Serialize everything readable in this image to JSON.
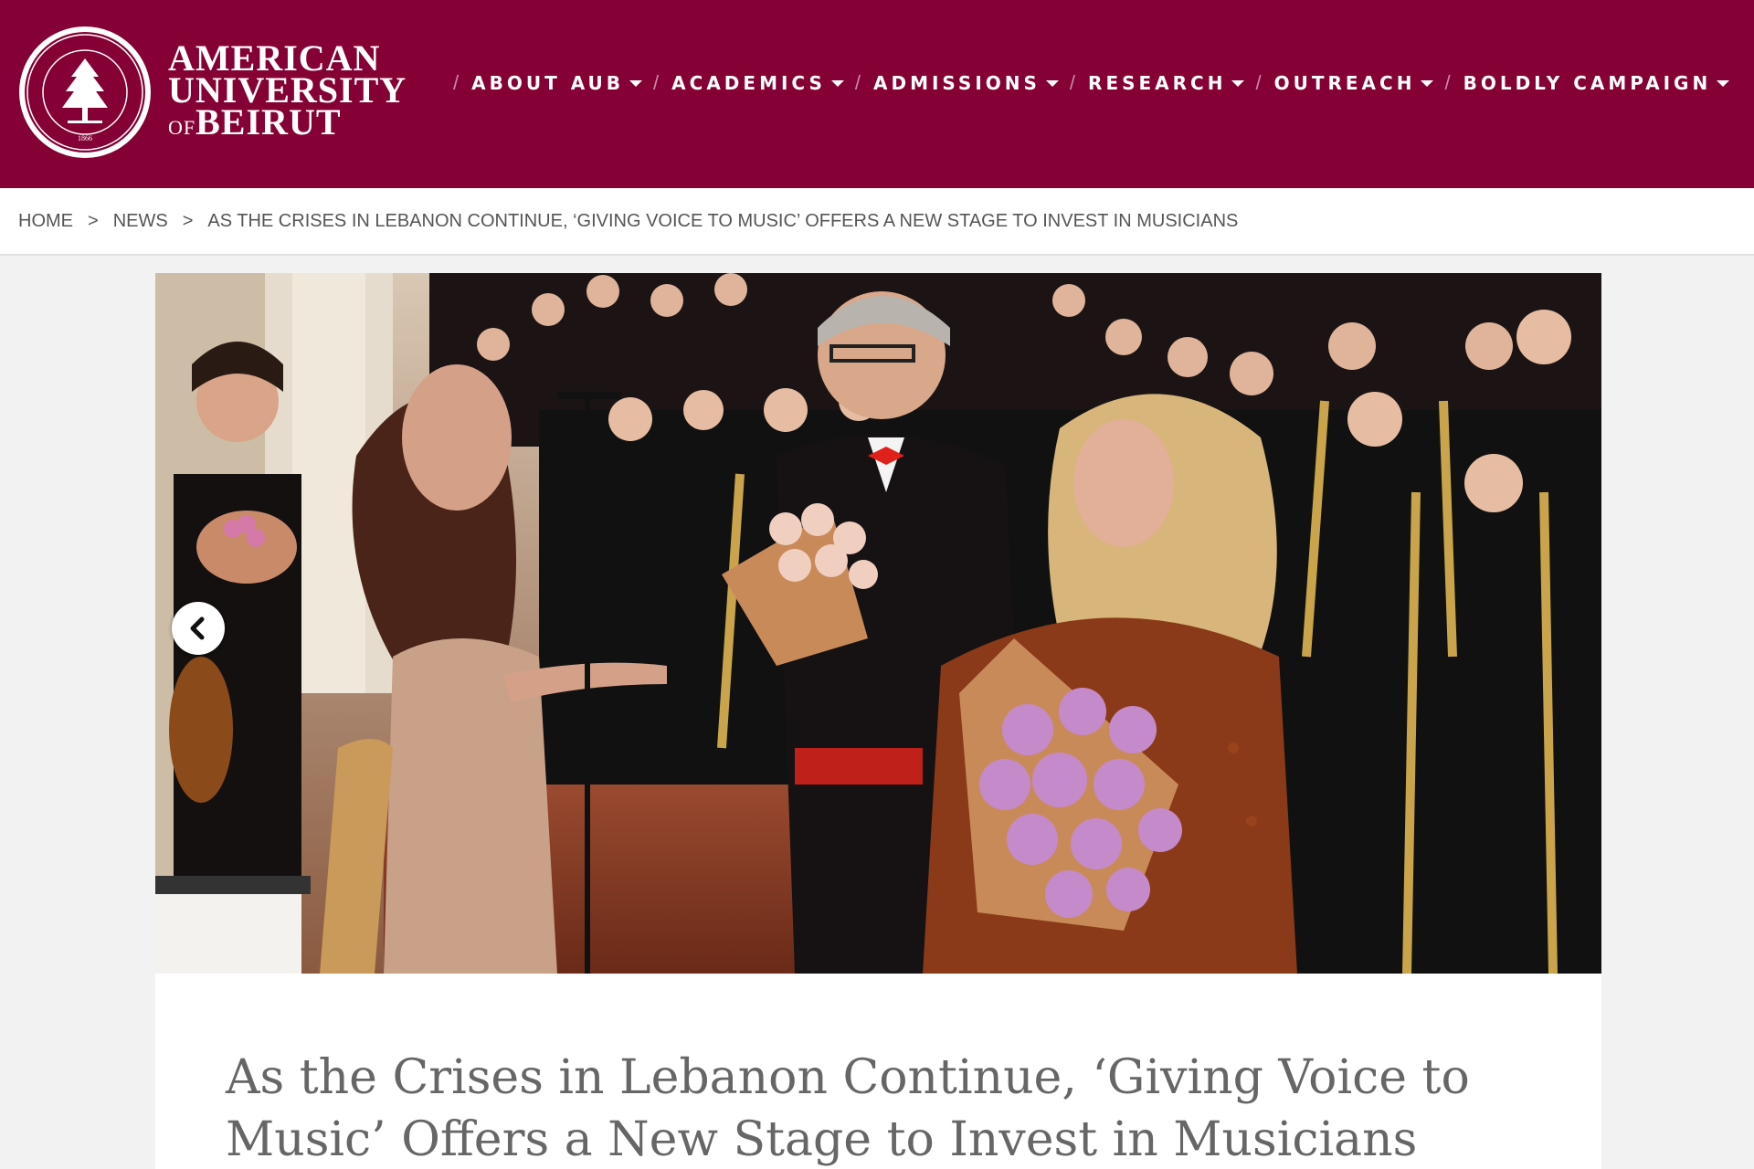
{
  "brand": {
    "line1": "AMERICAN",
    "line2": "UNIVERSITY",
    "line3_of": "OF",
    "line3": "BEIRUT",
    "seal_motto": "UT VITAM HABEANT ABUNDANTIUS HABEANT",
    "seal_year": "1866",
    "color": "#840035"
  },
  "nav": {
    "items": [
      {
        "label": "ABOUT AUB"
      },
      {
        "label": "ACADEMICS"
      },
      {
        "label": "ADMISSIONS"
      },
      {
        "label": "RESEARCH"
      },
      {
        "label": "OUTREACH"
      },
      {
        "label": "BOLDLY CAMPAIGN"
      }
    ]
  },
  "breadcrumb": {
    "home": "HOME",
    "sep": ">",
    "news": "NEWS",
    "current": "AS THE CRISES IN LEBANON CONTINUE, ‘GIVING VOICE TO MUSIC’ OFFERS A NEW STAGE TO INVEST IN MUSICIANS"
  },
  "hero": {
    "prev_icon": "chevron-left-icon"
  },
  "article": {
    "title": "As the Crises in Lebanon Continue, ‘Giving Voice to Music’ Offers a New Stage to Invest in Musicians"
  }
}
